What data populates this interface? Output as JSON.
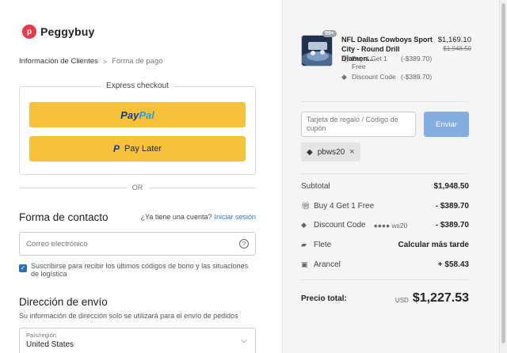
{
  "brand": {
    "logo_letter": "p",
    "name": "Peggybuy"
  },
  "breadcrumb": {
    "step1": "Información de Clientes",
    "separator": ">",
    "step2": "Forma de pago"
  },
  "express": {
    "title": "Express checkout",
    "paypal_p1": "Pay",
    "paypal_p2": "Pal",
    "paylater_icon": "P",
    "paylater_label": "Pay Later"
  },
  "or_label": "OR",
  "contact": {
    "title": "Forma de contacto",
    "account_q": "¿Ya tiene una cuenta?",
    "login_link": "Iniciar sesión",
    "email_placeholder": "Correo electrónico",
    "help_icon": "?",
    "subscribe_label": "Suscribirse para recibir los últimos códigos de bono y las situaciones de logística",
    "subscribe_checked": true,
    "checkmark": "✓"
  },
  "shipping": {
    "title": "Dirección de envío",
    "subtitle": "Su información de dirección solo se utilizará para el envío de pedidos",
    "region_label": "País/región",
    "region_value": "United States",
    "chevron": "⌵"
  },
  "order": {
    "product": {
      "qty_badge": "99+",
      "name": "NFL Dallas Cowboys Sport City - Round Drill Diamon...",
      "price": "$1,169.10",
      "old_price": "$1,948.50",
      "discount1_name": "Buy 4 Get 1 Free",
      "discount1_amount": "(-$389.70)",
      "discount2_name": "Discount Code",
      "discount2_amount": "(-$389.70)"
    },
    "gift_placeholder": "Tarjeta de regalo / Código de cupón",
    "apply_label": "Enviar",
    "applied_code": "pbws20",
    "remove_icon": "×",
    "subtotal_label": "Subtotal",
    "subtotal_value": "$1,948.50",
    "promo_label": "Buy 4 Get 1 Free",
    "promo_value": "- $389.70",
    "code_label": "Discount Code",
    "code_mask": "●●●● ws20",
    "code_value": "- $389.70",
    "shipping_label": "Flete",
    "shipping_value": "Calcular más tarde",
    "tariff_label": "Arancel",
    "tariff_value": "+ $58.43",
    "total_label": "Precio total:",
    "total_currency": "USD",
    "total_value": "$1,227.53"
  },
  "icons": {
    "gift": "gift-icon",
    "tag": "tag-icon",
    "truck": "truck-icon",
    "tariff": "tariff-icon"
  },
  "colors": {
    "paypal_yellow": "#f7c23a",
    "apply_blue": "#85aee0",
    "link_blue": "#3a7bc0",
    "brand_red": "#e83a4a"
  }
}
